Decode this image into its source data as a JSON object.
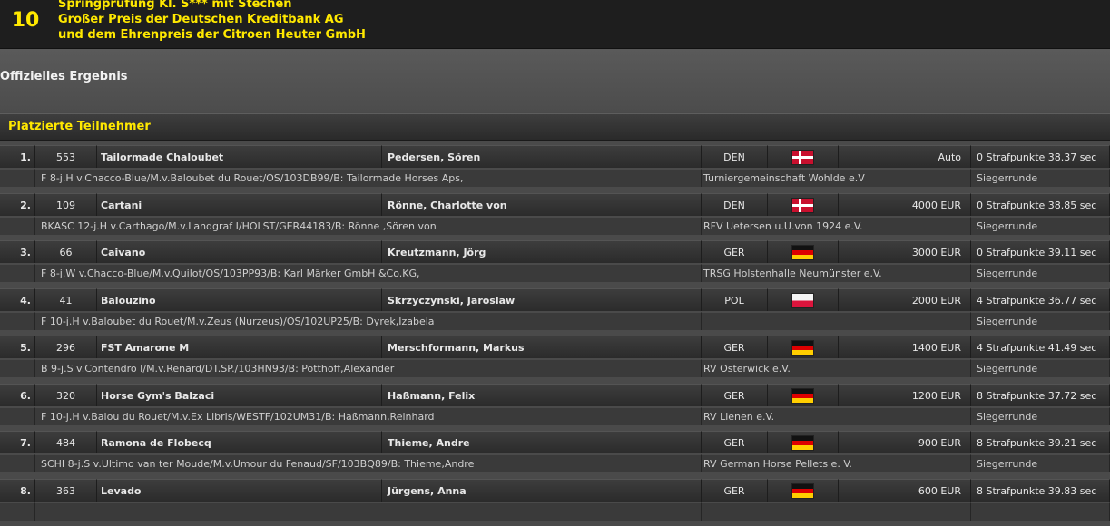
{
  "competition": {
    "number": "10",
    "title_lines": [
      "Springprüfung Kl. S*** mit Stechen",
      "Großer Preis der Deutschen Kreditbank AG",
      "und dem Ehrenpreis der Citroen Heuter GmbH"
    ]
  },
  "subtitle": "Offizielles Ergebnis",
  "section_title": "Platzierte Teilnehmer",
  "colors": {
    "accent": "#ffe800",
    "header_bg": "#1e1e1e",
    "row_bg": "#333333"
  },
  "entries": [
    {
      "rank": "1.",
      "number": "553",
      "horse": "Tailormade Chaloubet",
      "rider": "Pedersen, Sören",
      "nation": "DEN",
      "flag_icon": "denmark-flag-icon",
      "prize": "Auto",
      "result": "0 Strafpunkte 38.37 sec",
      "horse_info": "F 8-j.H v.Chacco-Blue/M.v.Baloubet du Rouet/OS/103DB99/B: Tailormade Horses Aps,",
      "club": "Turniergemeinschaft Wohlde e.V",
      "round": "Siegerrunde"
    },
    {
      "rank": "2.",
      "number": "109",
      "horse": "Cartani",
      "rider": "Rönne, Charlotte von",
      "nation": "DEN",
      "flag_icon": "denmark-flag-icon",
      "prize": "4000 EUR",
      "result": "0 Strafpunkte 38.85 sec",
      "horse_info": "BKASC 12-j.H v.Carthago/M.v.Landgraf I/HOLST/GER44183/B: Rönne ,Sören von",
      "club": "RFV Uetersen u.U.von 1924 e.V.",
      "round": "Siegerrunde"
    },
    {
      "rank": "3.",
      "number": "66",
      "horse": "Caivano",
      "rider": "Kreutzmann, Jörg",
      "nation": "GER",
      "flag_icon": "germany-flag-icon",
      "prize": "3000 EUR",
      "result": "0 Strafpunkte 39.11 sec",
      "horse_info": "F 8-j.W v.Chacco-Blue/M.v.Quilot/OS/103PP93/B: Karl Märker GmbH &Co.KG,",
      "club": "TRSG Holstenhalle Neumünster e.V.",
      "round": "Siegerrunde"
    },
    {
      "rank": "4.",
      "number": "41",
      "horse": "Balouzino",
      "rider": "Skrzyczynski, Jaroslaw",
      "nation": "POL",
      "flag_icon": "poland-flag-icon",
      "prize": "2000 EUR",
      "result": "4 Strafpunkte 36.77 sec",
      "horse_info": "F 10-j.H v.Baloubet du Rouet/M.v.Zeus (Nurzeus)/OS/102UP25/B: Dyrek,Izabela",
      "club": "",
      "round": "Siegerrunde"
    },
    {
      "rank": "5.",
      "number": "296",
      "horse": "FST Amarone M",
      "rider": "Merschformann, Markus",
      "nation": "GER",
      "flag_icon": "germany-flag-icon",
      "prize": "1400 EUR",
      "result": "4 Strafpunkte 41.49 sec",
      "horse_info": "B 9-j.S v.Contendro I/M.v.Renard/DT.SP./103HN93/B: Potthoff,Alexander",
      "club": "RV Osterwick e.V.",
      "round": "Siegerrunde"
    },
    {
      "rank": "6.",
      "number": "320",
      "horse": "Horse Gym's Balzaci",
      "rider": "Haßmann, Felix",
      "nation": "GER",
      "flag_icon": "germany-flag-icon",
      "prize": "1200 EUR",
      "result": "8 Strafpunkte 37.72 sec",
      "horse_info": "F 10-j.H v.Balou du Rouet/M.v.Ex Libris/WESTF/102UM31/B: Haßmann,Reinhard",
      "club": "RV Lienen e.V.",
      "round": "Siegerrunde"
    },
    {
      "rank": "7.",
      "number": "484",
      "horse": "Ramona de Flobecq",
      "rider": "Thieme, Andre",
      "nation": "GER",
      "flag_icon": "germany-flag-icon",
      "prize": "900 EUR",
      "result": "8 Strafpunkte 39.21 sec",
      "horse_info": "SCHI 8-j.S v.Ultimo van ter Moude/M.v.Umour du Fenaud/SF/103BQ89/B: Thieme,Andre",
      "club": "RV German Horse Pellets e. V.",
      "round": "Siegerrunde"
    },
    {
      "rank": "8.",
      "number": "363",
      "horse": "Levado",
      "rider": "Jürgens, Anna",
      "nation": "GER",
      "flag_icon": "germany-flag-icon",
      "prize": "600 EUR",
      "result": "8 Strafpunkte 39.83 sec",
      "horse_info": "",
      "club": "",
      "round": ""
    }
  ]
}
